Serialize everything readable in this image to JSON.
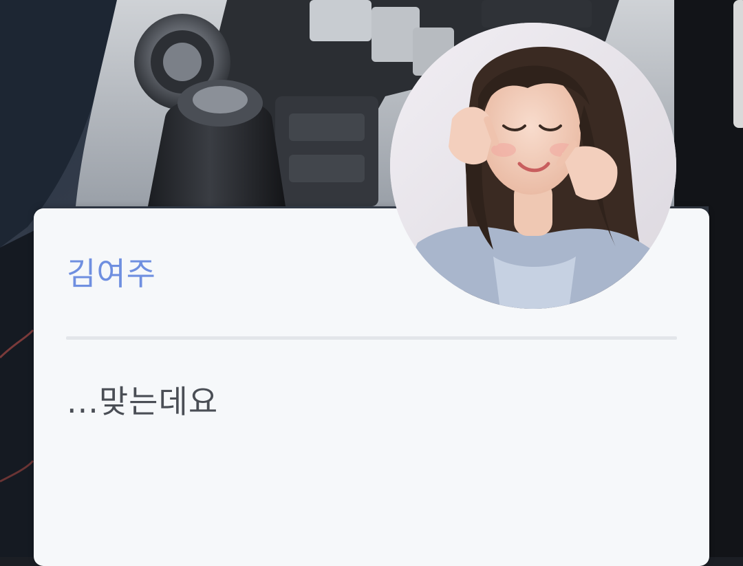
{
  "dialog": {
    "speaker_name": "김여주",
    "message": "...맞는데요"
  },
  "colors": {
    "speaker": "#6f8fe0",
    "message": "#4a4e55",
    "card_background": "#f6f8fa",
    "divider": "#e3e6ea"
  },
  "icons": {
    "avatar": "profile-photo",
    "background": "car-interior-photo"
  }
}
